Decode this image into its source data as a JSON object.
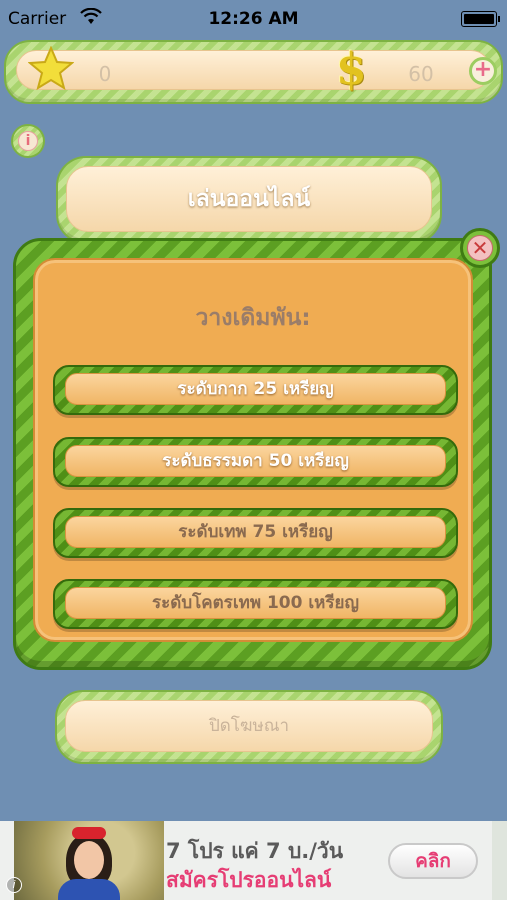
{
  "status_bar": {
    "carrier": "Carrier",
    "time": "12:26 AM"
  },
  "top_bar": {
    "coins": "0",
    "money": "60",
    "add_label": "+"
  },
  "info_label": "i",
  "online_button": {
    "label": "เล่นออนไลน์"
  },
  "dialog": {
    "title": "วางเดิมพัน:",
    "close_label": "✕",
    "options": [
      {
        "label": "ระดับกาก 25 เหรียญ"
      },
      {
        "label": "ระดับธรรมดา 50 เหรียญ"
      },
      {
        "label": "ระดับเทพ 75 เหรียญ"
      },
      {
        "label": "ระดับโคตรเทพ 100 เหรียญ"
      }
    ]
  },
  "close_ad_button": {
    "label": "ปิดโฆษณา"
  },
  "ad": {
    "line1": "7 โปร แค่ 7 บ./วัน",
    "line2": "สมัครโปรออนไลน์",
    "cta": "คลิก",
    "info": "i"
  },
  "colors": {
    "background": "#6f8fb3",
    "dialog_green": "#5c9f22",
    "dialog_orange": "#f0ac52",
    "accent_pink": "#e63d74"
  }
}
